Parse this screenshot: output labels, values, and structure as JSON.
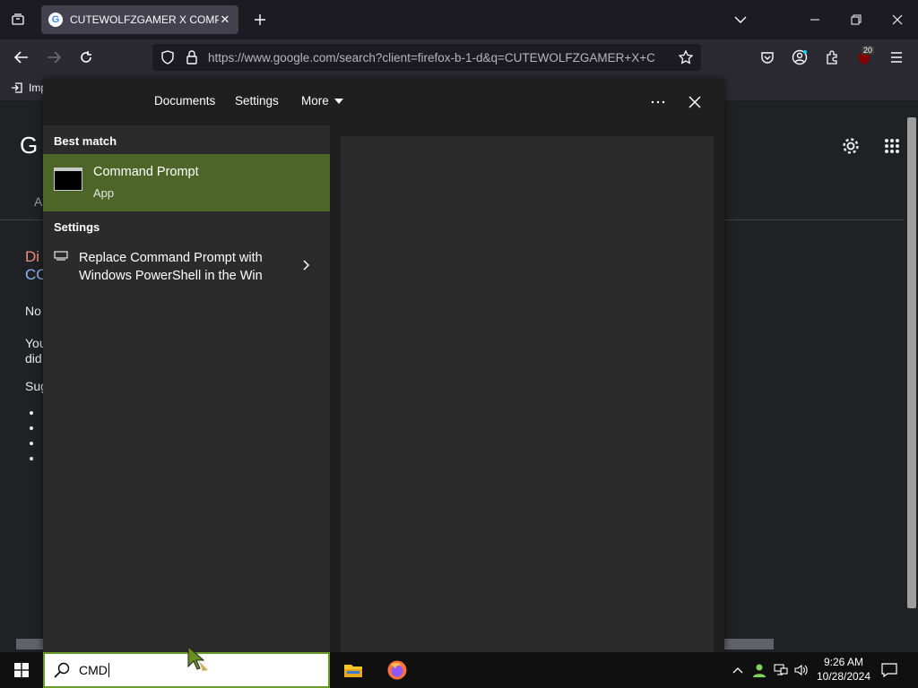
{
  "browser": {
    "tab_title": "CUTEWOLFZGAMER X COMPU",
    "url": "https://www.google.com/search?client=firefox-b-1-d&q=CUTEWOLFZGAMER+X+C",
    "bookmark_label": "Imp",
    "badge_count": "20"
  },
  "page": {
    "logo_letter": "G",
    "partial_1": "Di",
    "partial_2": "CO",
    "partial_3": "A",
    "partial_4": "No",
    "partial_5": "You",
    "partial_6": "did",
    "partial_7": "Sug"
  },
  "search_panel": {
    "tabs": [
      "Documents",
      "Settings",
      "More"
    ],
    "more_label": "More",
    "best_match_label": "Best match",
    "best_match_title": "Command Prompt",
    "best_match_subtitle": "App",
    "settings_label": "Settings",
    "setting_item": "Replace Command Prompt with Windows PowerShell in the Win"
  },
  "taskbar": {
    "search_value": "CMD",
    "time": "9:26 AM",
    "date": "10/28/2024"
  },
  "colors": {
    "accent_green": "#4d6527",
    "search_border": "#6a9b2d"
  }
}
